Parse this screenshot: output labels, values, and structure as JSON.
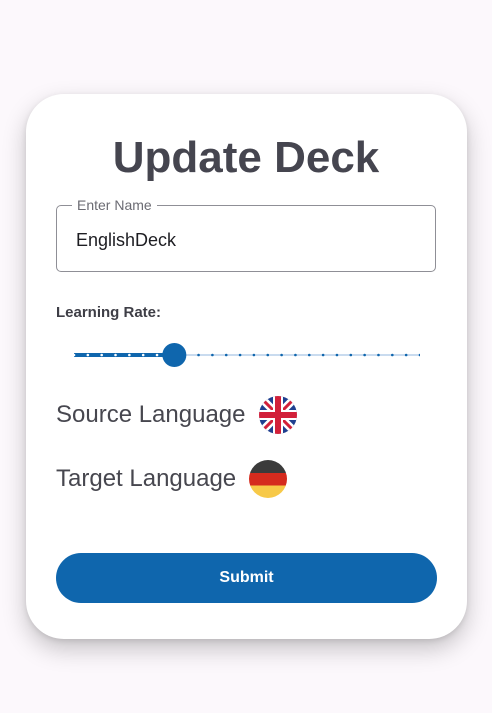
{
  "dialog": {
    "title": "Update Deck"
  },
  "name_field": {
    "label": "Enter Name",
    "value": "EnglishDeck"
  },
  "learning_rate": {
    "label": "Learning Rate:",
    "value_fraction": 0.29,
    "steps": 25
  },
  "languages": {
    "source": {
      "label": "Source Language",
      "flag_icon": "uk-flag-icon"
    },
    "target": {
      "label": "Target Language",
      "flag_icon": "germany-flag-icon"
    }
  },
  "submit": {
    "label": "Submit"
  },
  "colors": {
    "accent": "#0f66ad",
    "title_text": "#45454f",
    "page_background": "#fcf8fc"
  }
}
